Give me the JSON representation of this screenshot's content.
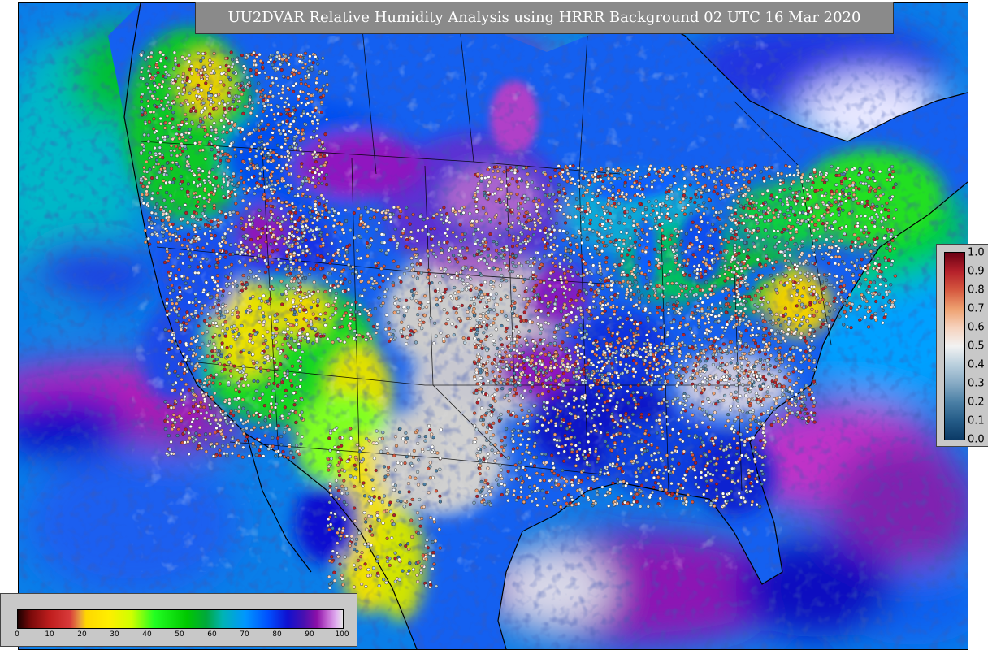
{
  "title": "UU2DVAR Relative Humidity Analysis using HRRR Background 02 UTC 16 Mar 2020",
  "rh_colorbar": {
    "ticks": [
      "0",
      "10",
      "20",
      "30",
      "40",
      "50",
      "60",
      "70",
      "80",
      "90",
      "100"
    ],
    "range": [
      0,
      100
    ],
    "stops": [
      {
        "v": 0,
        "color": "#1a0000"
      },
      {
        "v": 4,
        "color": "#7a0a0a"
      },
      {
        "v": 10,
        "color": "#c01e1e"
      },
      {
        "v": 16,
        "color": "#d83a3a"
      },
      {
        "v": 19,
        "color": "#e89a40"
      },
      {
        "v": 21,
        "color": "#ffd700"
      },
      {
        "v": 28,
        "color": "#ffee00"
      },
      {
        "v": 35,
        "color": "#cfff00"
      },
      {
        "v": 42,
        "color": "#22ff22"
      },
      {
        "v": 52,
        "color": "#00c800"
      },
      {
        "v": 58,
        "color": "#00a83c"
      },
      {
        "v": 63,
        "color": "#00b4b4"
      },
      {
        "v": 70,
        "color": "#0096ff"
      },
      {
        "v": 77,
        "color": "#0050ff"
      },
      {
        "v": 83,
        "color": "#1010d0"
      },
      {
        "v": 88,
        "color": "#4810b0"
      },
      {
        "v": 92,
        "color": "#8c10a8"
      },
      {
        "v": 95,
        "color": "#c060d0"
      },
      {
        "v": 98,
        "color": "#e0b0f0"
      },
      {
        "v": 100,
        "color": "#e6e6e6"
      }
    ]
  },
  "ratio_colorbar": {
    "ticks": [
      "1.0",
      "0.9",
      "0.8",
      "0.7",
      "0.6",
      "0.5",
      "0.4",
      "0.3",
      "0.2",
      "0.1",
      "0.0"
    ],
    "range": [
      0,
      1
    ],
    "stops": [
      {
        "v": 0.0,
        "color": "#0b3a66"
      },
      {
        "v": 0.1,
        "color": "#245b87"
      },
      {
        "v": 0.2,
        "color": "#4a7fa5"
      },
      {
        "v": 0.3,
        "color": "#86aac4"
      },
      {
        "v": 0.4,
        "color": "#b9cfdd"
      },
      {
        "v": 0.5,
        "color": "#f2f2f2"
      },
      {
        "v": 0.6,
        "color": "#f6d2bd"
      },
      {
        "v": 0.7,
        "color": "#eea06f"
      },
      {
        "v": 0.8,
        "color": "#d5583f"
      },
      {
        "v": 0.9,
        "color": "#b5202a"
      },
      {
        "v": 1.0,
        "color": "#6b0014"
      }
    ]
  }
}
